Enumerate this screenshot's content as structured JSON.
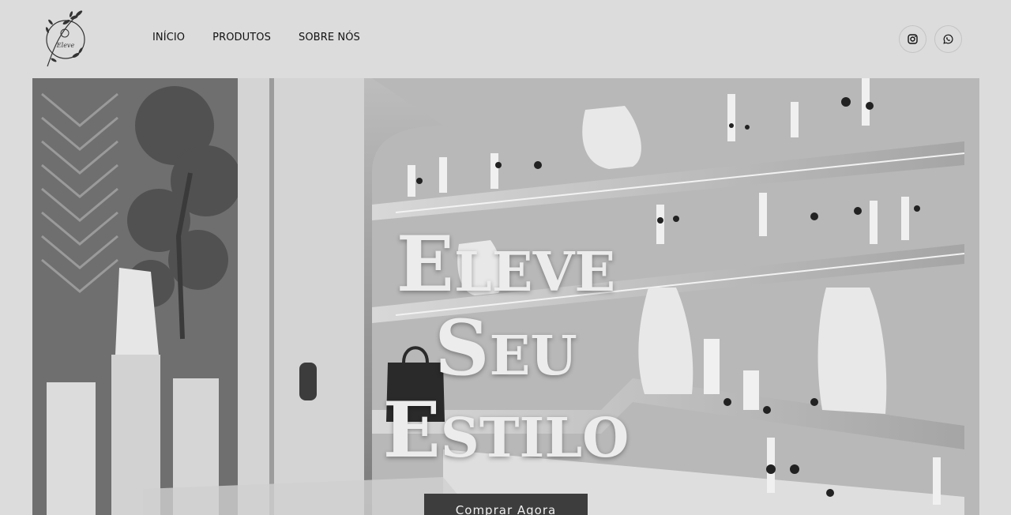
{
  "header": {
    "logo_text": "Eleve",
    "nav": [
      {
        "label": "INÍCIO"
      },
      {
        "label": "PRODUTOS"
      },
      {
        "label": "SOBRE NÓS"
      }
    ],
    "social": [
      {
        "icon": "instagram-icon"
      },
      {
        "icon": "whatsapp-icon"
      }
    ]
  },
  "hero": {
    "line1_cap": "E",
    "line1_rest": "LEVE",
    "line2_cap": "S",
    "line2_rest": "EU",
    "line3_cap": "E",
    "line3_rest": "STILO",
    "cta_label": "Comprar Agora"
  },
  "colors": {
    "background": "#dcdcdc",
    "headline": "#ececec",
    "cta_bg": "#3d3d3d"
  }
}
